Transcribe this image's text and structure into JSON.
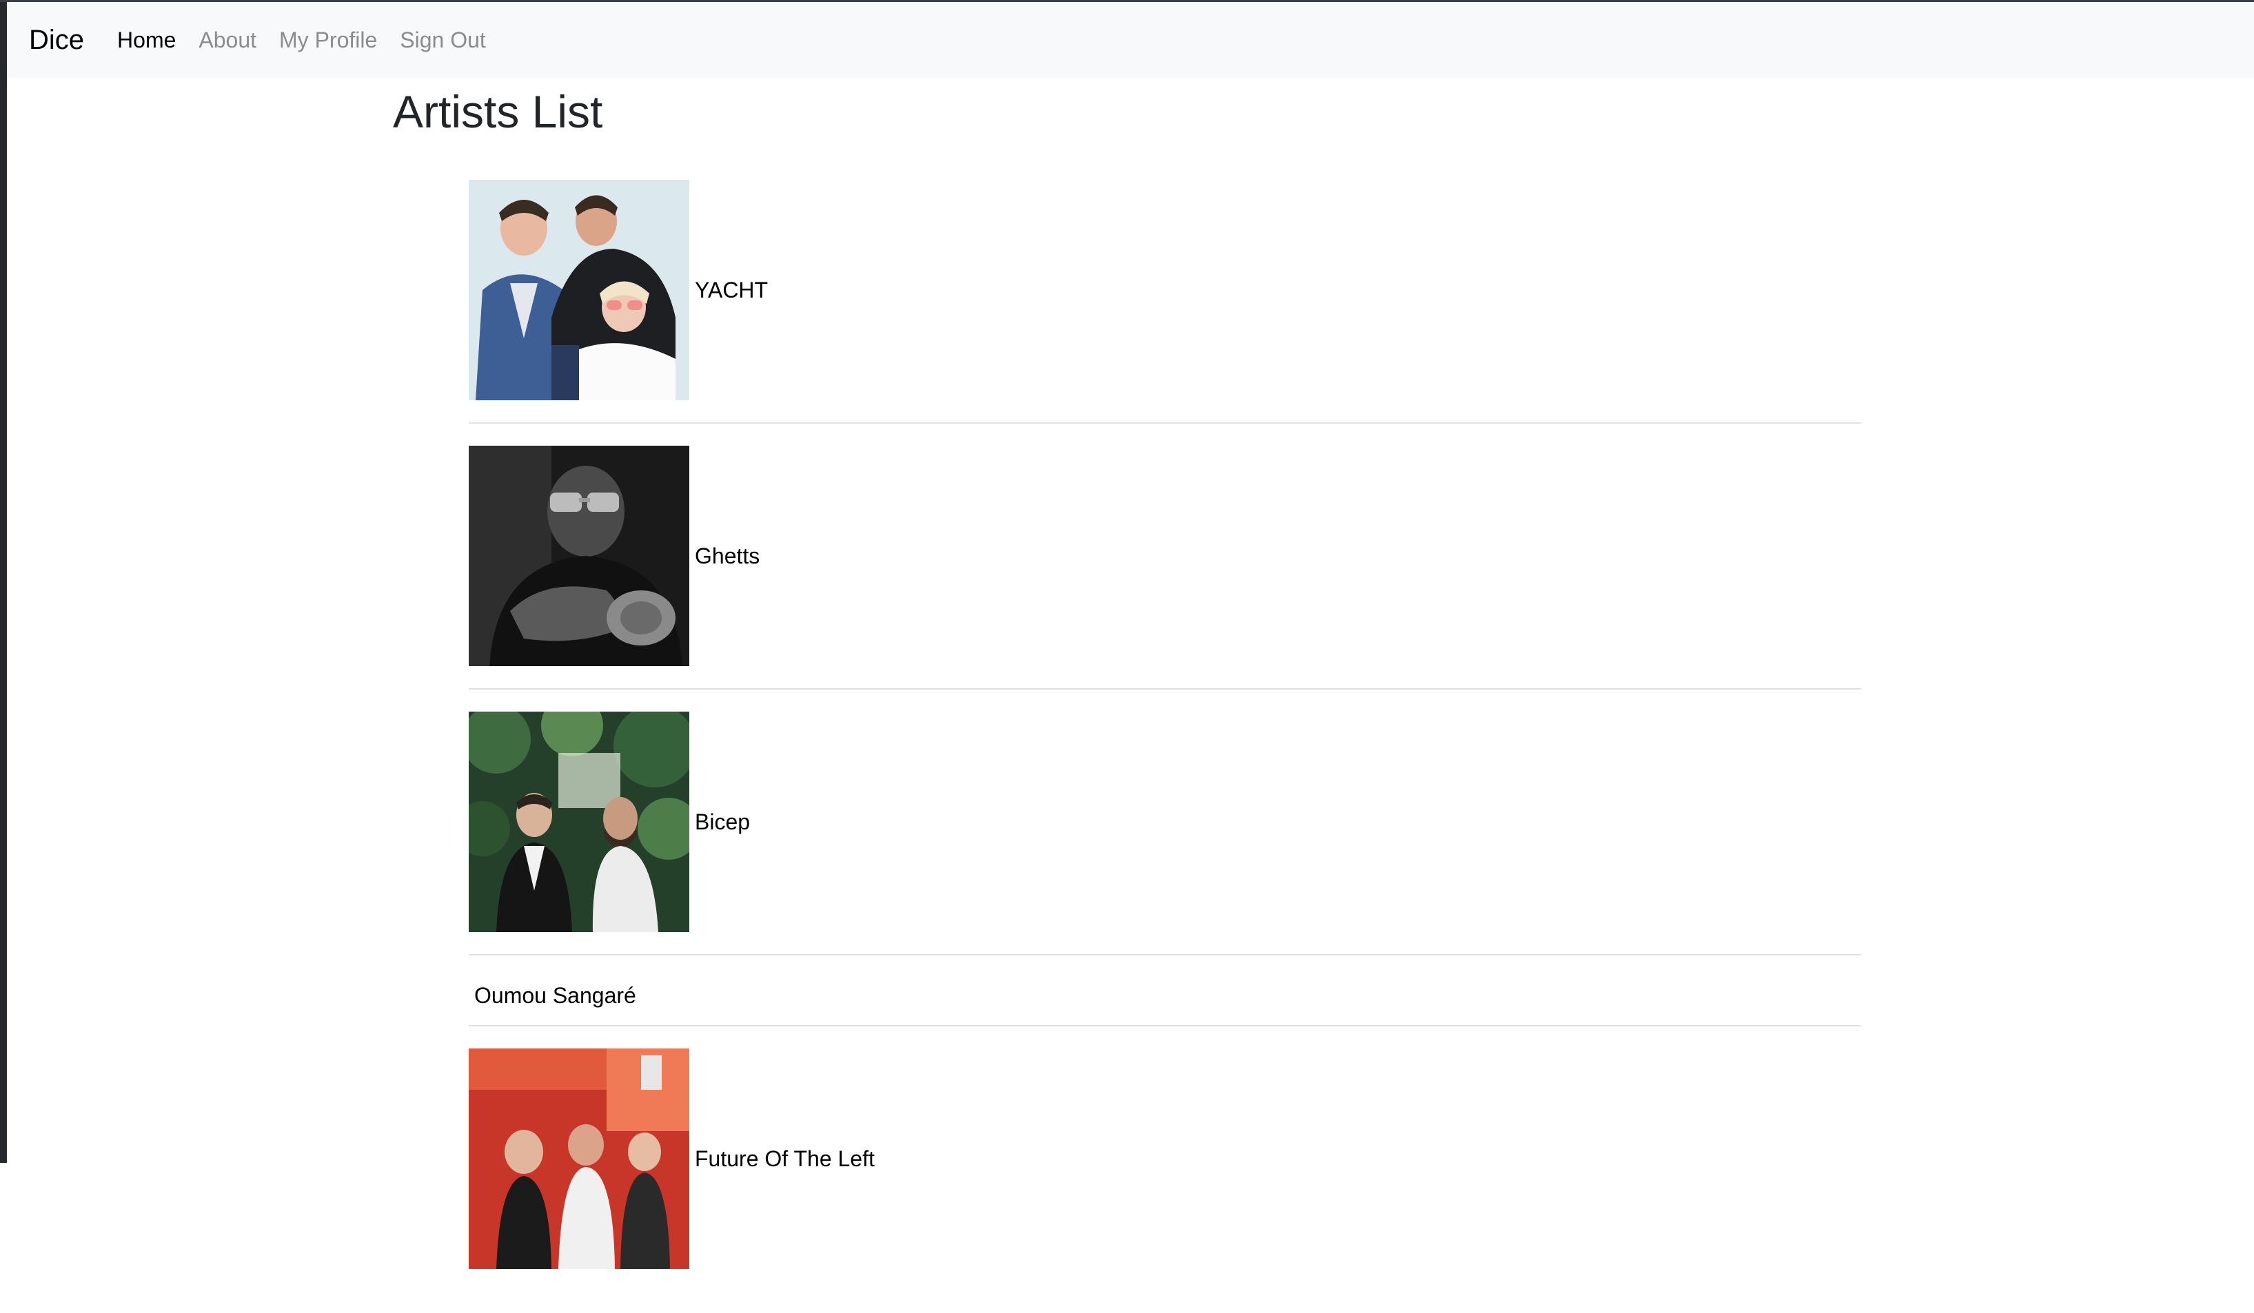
{
  "navbar": {
    "brand": "Dice",
    "links": [
      {
        "label": "Home",
        "active": true
      },
      {
        "label": "About",
        "active": false
      },
      {
        "label": "My Profile",
        "active": false
      },
      {
        "label": "Sign Out",
        "active": false
      }
    ]
  },
  "page": {
    "title": "Artists List"
  },
  "artists": [
    {
      "name": "YACHT",
      "has_photo": true
    },
    {
      "name": "Ghetts",
      "has_photo": true
    },
    {
      "name": "Bicep",
      "has_photo": true
    },
    {
      "name": "Oumou Sangaré",
      "has_photo": false
    },
    {
      "name": "Future Of The Left",
      "has_photo": true
    }
  ],
  "colors": {
    "navbar_bg": "#f8f9fa",
    "nav_inactive": "#8c8c8c",
    "nav_active": "#000000",
    "divider": "#dee2e6"
  }
}
